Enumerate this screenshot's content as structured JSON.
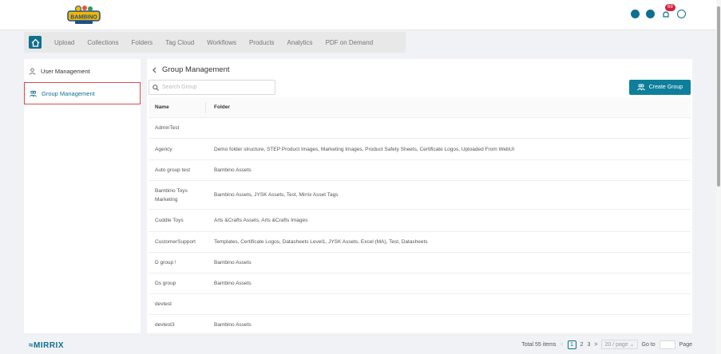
{
  "header": {
    "logo_text": "BAMBINO",
    "notification_count": "69"
  },
  "nav": {
    "items": [
      "Upload",
      "Collections",
      "Folders",
      "Tag Cloud",
      "Workflows",
      "Products",
      "Analytics",
      "PDF on Demand"
    ]
  },
  "sidebar": {
    "items": [
      {
        "label": "User Management",
        "icon": "user-icon"
      },
      {
        "label": "Group Management",
        "icon": "group-icon",
        "selected": true
      }
    ]
  },
  "main": {
    "title": "Group Management",
    "search_placeholder": "Search Group",
    "create_label": "Create Group",
    "columns": [
      "Name",
      "Folder"
    ],
    "rows": [
      {
        "name": "AdminTest",
        "folder": ""
      },
      {
        "name": "Agency",
        "folder": "Demo folder structure, STEP Product Images, Marketing Images, Product Safety Sheets, Certificate Logos, Uploaded From WebUI"
      },
      {
        "name": "Auto group test",
        "folder": "Bambino Assets"
      },
      {
        "name": "Bambino Toys Marketing",
        "folder": "Bambino Assets, JYSK Assets, Test, Mirrix Asset Tags"
      },
      {
        "name": "Cuddle Toys",
        "folder": "Arts &Crafts Assets, Arts &Crafts Images"
      },
      {
        "name": "CustomerSupport",
        "folder": "Templates, Certificate Logos, Datasheets Level1, JYSK Assets, Excel (MA), Test, Datasheets"
      },
      {
        "name": "D group !",
        "folder": "Bambino Assets"
      },
      {
        "name": "Ds group",
        "folder": "Bambino Assets"
      },
      {
        "name": "devtest",
        "folder": ""
      },
      {
        "name": "devtest3",
        "folder": "Bambino Assets"
      }
    ]
  },
  "footer": {
    "brand": "MIRRIX",
    "total": "Total 55 items",
    "pages": [
      "1",
      "2",
      "3"
    ],
    "page_size": "20 / page",
    "goto_label": "Go to",
    "page_label": "Page"
  },
  "colors": {
    "accent": "#0e7f9b",
    "selected_border": "#e04a4a",
    "badge": "#d4213d"
  }
}
